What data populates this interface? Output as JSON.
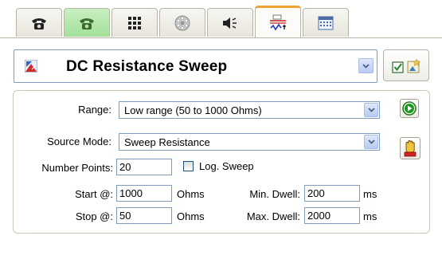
{
  "tabs": [
    {
      "icon": "telephone-icon"
    },
    {
      "icon": "telephone-green-icon"
    },
    {
      "icon": "keypad-grid-icon"
    },
    {
      "icon": "dial-disc-icon"
    },
    {
      "icon": "speaker-icon"
    },
    {
      "icon": "signal-waveform-icon",
      "active": true
    },
    {
      "icon": "calendar-grid-icon"
    }
  ],
  "module": {
    "title": "DC Resistance Sweep",
    "icon": "resistance-module-icon",
    "side_icon": "checkbox-star-icon"
  },
  "form": {
    "range_label": "Range:",
    "range_value": "Low range (50 to 1000 Ohms)",
    "source_mode_label": "Source Mode:",
    "source_mode_value": "Sweep Resistance",
    "number_points_label": "Number Points:",
    "number_points_value": "20",
    "log_sweep_label": "Log. Sweep",
    "log_sweep_checked": false,
    "start_label": "Start @:",
    "start_value": "1000",
    "start_unit": "Ohms",
    "stop_label": "Stop @:",
    "stop_value": "50",
    "stop_unit": "Ohms",
    "min_dwell_label": "Min. Dwell:",
    "min_dwell_value": "200",
    "min_dwell_unit": "ms",
    "max_dwell_label": "Max. Dwell:",
    "max_dwell_value": "2000",
    "max_dwell_unit": "ms"
  },
  "actions": {
    "run_icon": "play-icon",
    "stop_icon": "hand-stop-icon"
  },
  "colors": {
    "accent_tab": "#f0a230",
    "field_border": "#7f9db9",
    "run_green": "#1a9a1a"
  }
}
